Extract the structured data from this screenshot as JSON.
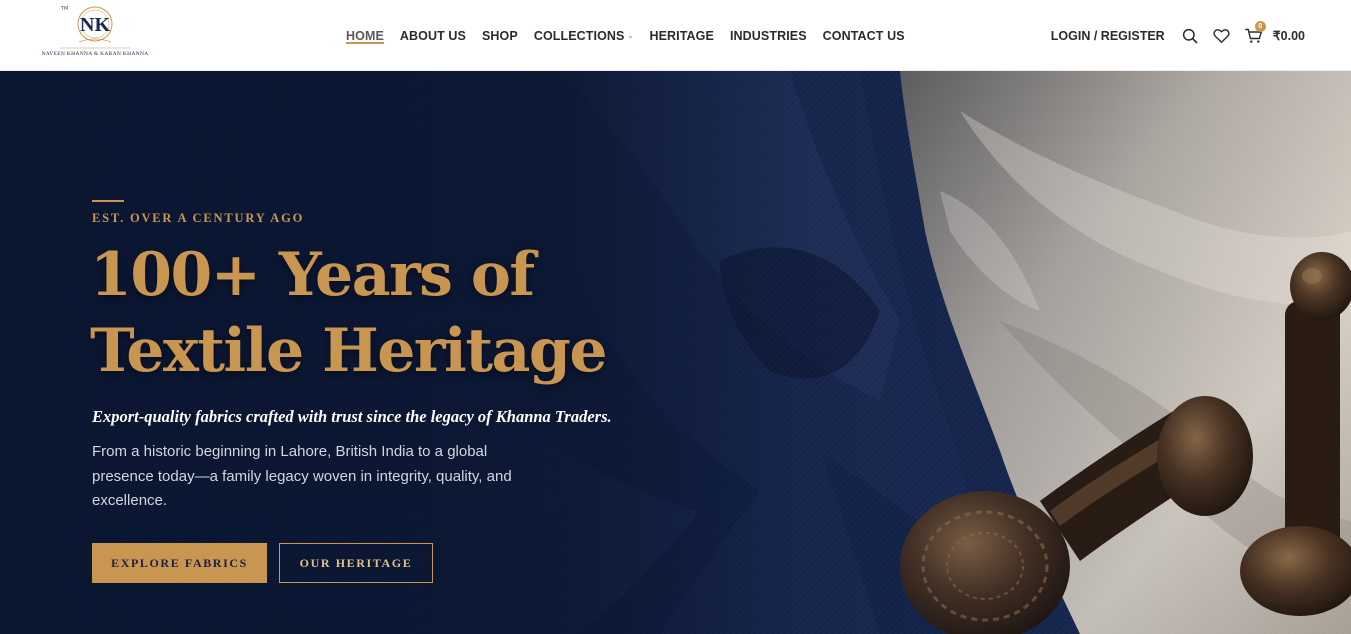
{
  "brand": {
    "monogram": "NK",
    "tm": "TM",
    "names": "NAVEEN KHANNA & KARAN KHANNA"
  },
  "nav": {
    "items": [
      {
        "label": "HOME",
        "active": true
      },
      {
        "label": "ABOUT US"
      },
      {
        "label": "SHOP"
      },
      {
        "label": "COLLECTIONS",
        "dropdown": true
      },
      {
        "label": "HERITAGE"
      },
      {
        "label": "INDUSTRIES"
      },
      {
        "label": "CONTACT US"
      }
    ]
  },
  "header_right": {
    "login_label": "LOGIN / REGISTER",
    "icons": [
      "search-icon",
      "heart-icon",
      "cart-icon"
    ],
    "cart_count": "0",
    "cart_total": "₹0.00"
  },
  "hero": {
    "eyebrow": "EST. OVER A CENTURY AGO",
    "headline_line1": "100+ Years of",
    "headline_line2": "Textile Heritage",
    "tagline": "Export-quality fabrics crafted with trust since the legacy of Khanna Traders.",
    "description": "From a historic beginning in Lahore, British India to a global presence today—a family legacy woven in integrity, quality, and excellence.",
    "primary_button": "EXPLORE FABRICS",
    "secondary_button": "OUR HERITAGE"
  },
  "colors": {
    "accent": "#c99652",
    "navy": "#0d1a38",
    "text_dark": "#2b2b2b"
  }
}
